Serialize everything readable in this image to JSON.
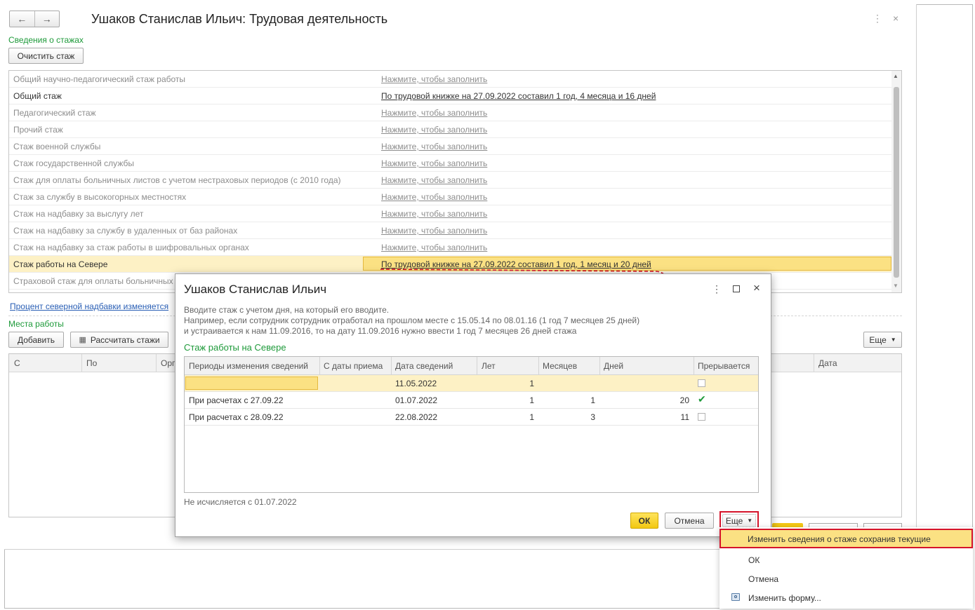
{
  "window": {
    "title": "Ушаков Станислав Ильич: Трудовая деятельность",
    "back_icon": "←",
    "forward_icon": "→",
    "more_icon": "⋮",
    "close_icon": "×"
  },
  "seniority": {
    "section_title": "Сведения о стажах",
    "clear_button": "Очистить стаж",
    "rows": [
      {
        "name": "Общий научно-педагогический стаж работы",
        "value": "Нажмите, чтобы заполнить"
      },
      {
        "name": "Общий стаж",
        "value": "По трудовой книжке на 27.09.2022 составил 1 год, 4 месяца и 16 дней"
      },
      {
        "name": "Педагогический стаж",
        "value": "Нажмите, чтобы заполнить"
      },
      {
        "name": "Прочий стаж",
        "value": "Нажмите, чтобы заполнить"
      },
      {
        "name": "Стаж военной службы",
        "value": "Нажмите, чтобы заполнить"
      },
      {
        "name": "Стаж государственной службы",
        "value": "Нажмите, чтобы заполнить"
      },
      {
        "name": "Стаж для оплаты больничных листов с учетом нестраховых периодов (с 2010 года)",
        "value": "Нажмите, чтобы заполнить"
      },
      {
        "name": "Стаж за службу в высокогорных местностях",
        "value": "Нажмите, чтобы заполнить"
      },
      {
        "name": "Стаж на надбавку за выслугу лет",
        "value": "Нажмите, чтобы заполнить"
      },
      {
        "name": "Стаж на надбавку за службу в удаленных от баз районах",
        "value": "Нажмите, чтобы заполнить"
      },
      {
        "name": "Стаж на надбавку за стаж работы в шифровальных органах",
        "value": "Нажмите, чтобы заполнить"
      },
      {
        "name": "Стаж работы на Севере",
        "value": "По трудовой книжке на 27.09.2022 составил 1 год, 1 месяц и 20 дней"
      },
      {
        "name": "Страховой стаж для оплаты больничных",
        "value": ""
      }
    ],
    "north_link": "Процент северной надбавки изменяется"
  },
  "workplaces": {
    "section_title": "Места работы",
    "add_button": "Добавить",
    "calc_button": "Рассчитать стажи",
    "more_button": "Еще",
    "columns": {
      "c1": "С",
      "c2": "По",
      "c3": "Орг",
      "c4": "Дата"
    }
  },
  "dialog": {
    "title": "Ушаков Станислав Ильич",
    "note1": "Вводите стаж с учетом дня, на который его вводите.",
    "note2": "Например, если сотрудник сотрудник отработал на прошлом месте с 15.05.14 по 08.01.16 (1 год 7 месяцев 25 дней)",
    "note3": "и устраивается к нам 11.09.2016, то на дату 11.09.2016 нужно ввести 1 год 7 месяцев 26 дней стажа",
    "section": "Стаж работы на Севере",
    "columns": {
      "period": "Периоды изменения сведений",
      "from_hire": "С даты приема",
      "date": "Дата сведений",
      "years": "Лет",
      "months": "Месяцев",
      "days": "Дней",
      "interrupted": "Прерывается"
    },
    "rows": [
      {
        "period": "",
        "from_hire": "",
        "date": "11.05.2022",
        "years": "1",
        "months": "",
        "days": "",
        "interrupted": false
      },
      {
        "period": "При расчетах с  27.09.22",
        "from_hire": "",
        "date": "01.07.2022",
        "years": "1",
        "months": "1",
        "days": "20",
        "interrupted": true
      },
      {
        "period": "При расчетах с  28.09.22",
        "from_hire": "",
        "date": "22.08.2022",
        "years": "1",
        "months": "3",
        "days": "11",
        "interrupted": false
      }
    ],
    "footer_note": "Не исчисляется с 01.07.2022",
    "ok_button": "ОК",
    "cancel_button": "Отмена",
    "more_button": "Еще"
  },
  "menu": {
    "items": [
      {
        "label": "Изменить сведения о стаже сохранив текущие",
        "highlighted": true
      },
      {
        "label": "ОК"
      },
      {
        "label": "Отмена"
      },
      {
        "label": "Изменить форму..."
      }
    ]
  },
  "colors": {
    "accent_green": "#1e9a3a",
    "selection_yellow": "#fdf1c5",
    "annotation_red": "#d5142b"
  }
}
